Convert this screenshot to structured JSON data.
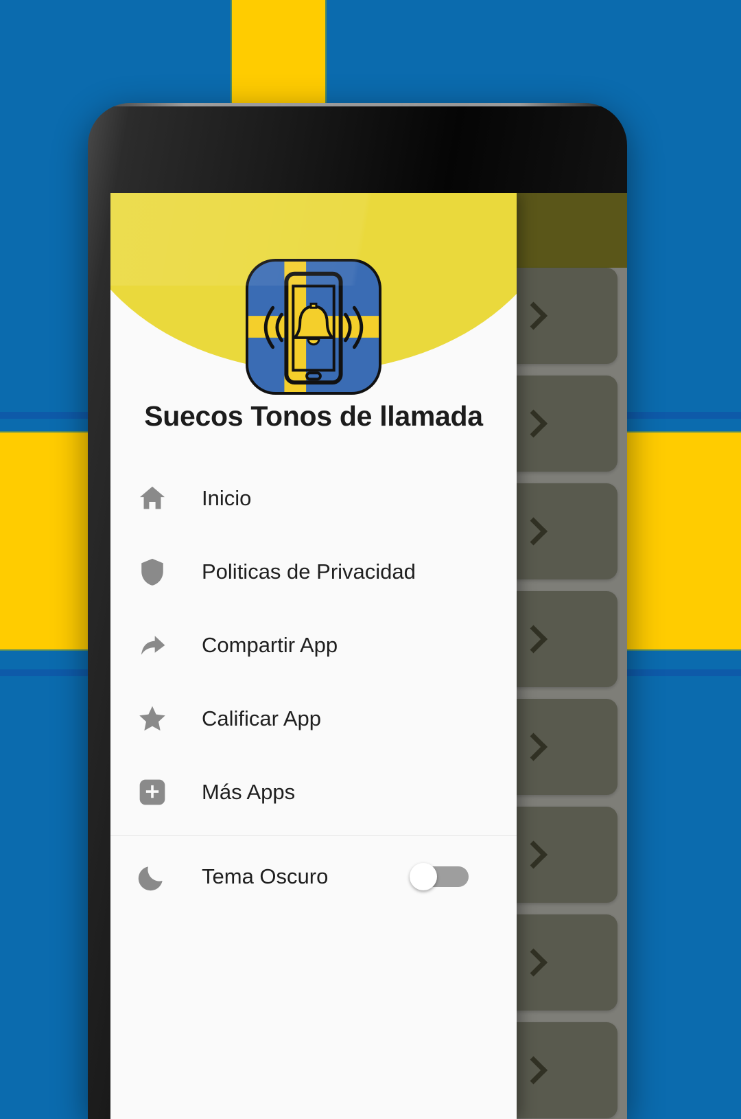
{
  "background": {
    "name": "swedish-flag",
    "blue": "#0b6bae",
    "yellow": "#ffcc00"
  },
  "device": {
    "name": "android-phone-mockup",
    "speaker": "speaker-grille",
    "camera": "front-camera"
  },
  "behind": {
    "appbar_color": "#6e6a1f",
    "card_color": "#6d6e60",
    "cards": [
      {
        "chevron": "›"
      },
      {
        "chevron": "›"
      },
      {
        "chevron": "›"
      },
      {
        "chevron": "›"
      },
      {
        "chevron": "›"
      },
      {
        "chevron": "›"
      },
      {
        "chevron": "›"
      },
      {
        "chevron": "›"
      }
    ]
  },
  "drawer": {
    "header": {
      "blob_color": "#ead93c",
      "app_title": "Suecos Tonos de llamada",
      "icon": {
        "name": "app-icon-swedish-ringtone",
        "blue": "#3a6cb4",
        "yellow": "#f4cf2b",
        "outline": "#111111"
      }
    },
    "items": [
      {
        "icon": "home-icon",
        "label": "Inicio"
      },
      {
        "icon": "shield-icon",
        "label": "Politicas de Privacidad"
      },
      {
        "icon": "share-arrow-icon",
        "label": "Compartir App"
      },
      {
        "icon": "star-icon",
        "label": "Calificar App"
      },
      {
        "icon": "plus-box-icon",
        "label": "Más Apps"
      }
    ],
    "theme_row": {
      "icon": "moon-icon",
      "label": "Tema Oscuro",
      "toggle_state": "off",
      "track_color": "#9e9e9e",
      "knob_color": "#ffffff"
    }
  }
}
